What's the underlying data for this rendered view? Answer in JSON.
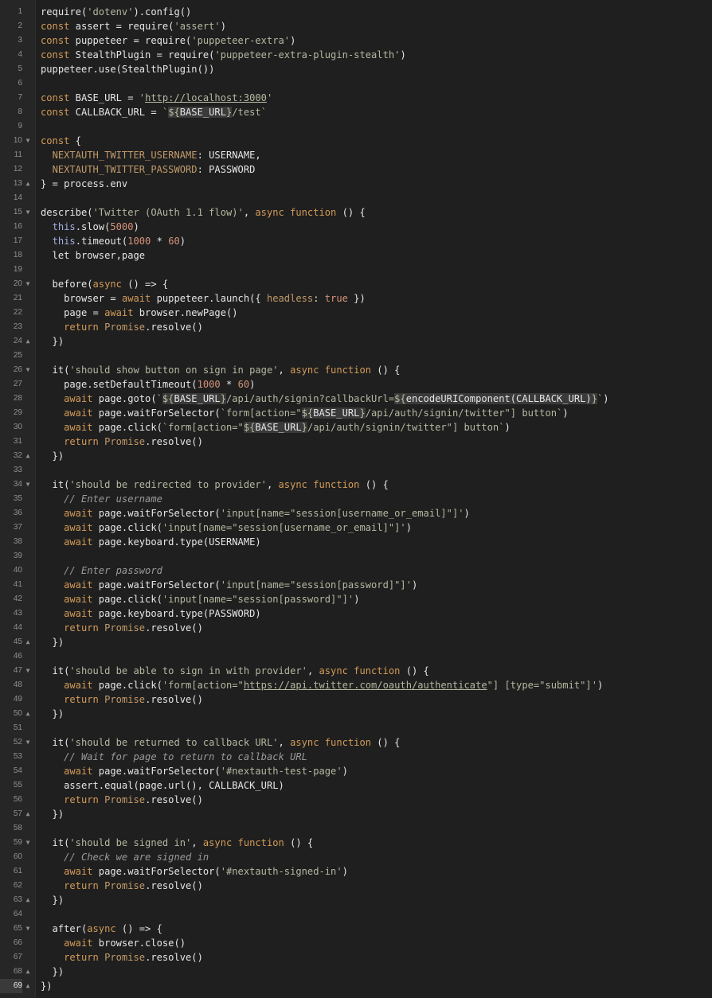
{
  "editor": {
    "current_line": 69,
    "lines": [
      {
        "n": 1,
        "segs": [
          [
            "p",
            "require("
          ],
          [
            "s",
            "'dotenv'"
          ],
          [
            "p",
            ").config()"
          ]
        ]
      },
      {
        "n": 2,
        "segs": [
          [
            "k",
            "const"
          ],
          [
            "p",
            " assert = require("
          ],
          [
            "s",
            "'assert'"
          ],
          [
            "p",
            ")"
          ]
        ]
      },
      {
        "n": 3,
        "segs": [
          [
            "k",
            "const"
          ],
          [
            "p",
            " puppeteer = require("
          ],
          [
            "s",
            "'puppeteer-extra'"
          ],
          [
            "p",
            ")"
          ]
        ]
      },
      {
        "n": 4,
        "segs": [
          [
            "k",
            "const"
          ],
          [
            "p",
            " StealthPlugin = require("
          ],
          [
            "s",
            "'puppeteer-extra-plugin-stealth'"
          ],
          [
            "p",
            ")"
          ]
        ]
      },
      {
        "n": 5,
        "segs": [
          [
            "p",
            "puppeteer.use(StealthPlugin())"
          ]
        ]
      },
      {
        "n": 6,
        "segs": []
      },
      {
        "n": 7,
        "segs": [
          [
            "k",
            "const"
          ],
          [
            "p",
            " BASE_URL = "
          ],
          [
            "s",
            "'"
          ],
          [
            "u",
            "http://localhost:3000"
          ],
          [
            "s",
            "'"
          ]
        ]
      },
      {
        "n": 8,
        "segs": [
          [
            "k",
            "const"
          ],
          [
            "p",
            " CALLBACK_URL = "
          ],
          [
            "s",
            "`"
          ],
          [
            "ip",
            "${BASE_URL}"
          ],
          [
            "s",
            "/test`"
          ]
        ]
      },
      {
        "n": 9,
        "segs": []
      },
      {
        "n": 10,
        "fold": "down",
        "segs": [
          [
            "k",
            "const"
          ],
          [
            "p",
            " {"
          ]
        ]
      },
      {
        "n": 11,
        "segs": [
          [
            "p",
            "  "
          ],
          [
            "cn",
            "NEXTAUTH_TWITTER_USERNAME"
          ],
          [
            "p",
            ": USERNAME,"
          ]
        ]
      },
      {
        "n": 12,
        "segs": [
          [
            "p",
            "  "
          ],
          [
            "cn",
            "NEXTAUTH_TWITTER_PASSWORD"
          ],
          [
            "p",
            ": PASSWORD"
          ]
        ]
      },
      {
        "n": 13,
        "fold": "up",
        "segs": [
          [
            "p",
            "} = process.env"
          ]
        ]
      },
      {
        "n": 14,
        "segs": []
      },
      {
        "n": 15,
        "fold": "down",
        "segs": [
          [
            "p",
            "describe("
          ],
          [
            "s",
            "'Twitter (OAuth 1.1 flow)'"
          ],
          [
            "p",
            ", "
          ],
          [
            "k",
            "async function"
          ],
          [
            "p",
            " () {"
          ]
        ]
      },
      {
        "n": 16,
        "segs": [
          [
            "p",
            "  "
          ],
          [
            "ti",
            "this"
          ],
          [
            "p",
            ".slow("
          ],
          [
            "n",
            "5000"
          ],
          [
            "p",
            ")"
          ]
        ]
      },
      {
        "n": 17,
        "segs": [
          [
            "p",
            "  "
          ],
          [
            "ti",
            "this"
          ],
          [
            "p",
            ".timeout("
          ],
          [
            "n",
            "1000"
          ],
          [
            "p",
            " * "
          ],
          [
            "n",
            "60"
          ],
          [
            "p",
            ")"
          ]
        ]
      },
      {
        "n": 18,
        "segs": [
          [
            "p",
            "  let browser,page"
          ]
        ]
      },
      {
        "n": 19,
        "segs": []
      },
      {
        "n": 20,
        "fold": "down",
        "segs": [
          [
            "p",
            "  before("
          ],
          [
            "k",
            "async"
          ],
          [
            "p",
            " () => {"
          ]
        ]
      },
      {
        "n": 21,
        "segs": [
          [
            "p",
            "    browser = "
          ],
          [
            "k",
            "await"
          ],
          [
            "p",
            " puppeteer.launch({ "
          ],
          [
            "cn",
            "headless"
          ],
          [
            "p",
            ": "
          ],
          [
            "b",
            "true"
          ],
          [
            "p",
            " })"
          ]
        ]
      },
      {
        "n": 22,
        "segs": [
          [
            "p",
            "    page = "
          ],
          [
            "k",
            "await"
          ],
          [
            "p",
            " browser.newPage()"
          ]
        ]
      },
      {
        "n": 23,
        "segs": [
          [
            "p",
            "    "
          ],
          [
            "k",
            "return"
          ],
          [
            "p",
            " "
          ],
          [
            "cn",
            "Promise"
          ],
          [
            "p",
            ".resolve()"
          ]
        ]
      },
      {
        "n": 24,
        "fold": "up",
        "segs": [
          [
            "p",
            "  })"
          ]
        ]
      },
      {
        "n": 25,
        "segs": []
      },
      {
        "n": 26,
        "fold": "down",
        "segs": [
          [
            "p",
            "  it("
          ],
          [
            "s",
            "'should show button on sign in page'"
          ],
          [
            "p",
            ", "
          ],
          [
            "k",
            "async function"
          ],
          [
            "p",
            " () {"
          ]
        ]
      },
      {
        "n": 27,
        "segs": [
          [
            "p",
            "    page.setDefaultTimeout("
          ],
          [
            "n",
            "1000"
          ],
          [
            "p",
            " * "
          ],
          [
            "n",
            "60"
          ],
          [
            "p",
            ")"
          ]
        ]
      },
      {
        "n": 28,
        "segs": [
          [
            "p",
            "    "
          ],
          [
            "k",
            "await"
          ],
          [
            "p",
            " page.goto("
          ],
          [
            "s",
            "`"
          ],
          [
            "ip",
            "${BASE_URL}"
          ],
          [
            "s",
            "/api/auth/signin?callbackUrl="
          ],
          [
            "ip",
            "${encodeURIComponent(CALLBACK_URL)}"
          ],
          [
            "s",
            "`"
          ],
          [
            "p",
            ")"
          ]
        ]
      },
      {
        "n": 29,
        "segs": [
          [
            "p",
            "    "
          ],
          [
            "k",
            "await"
          ],
          [
            "p",
            " page.waitForSelector("
          ],
          [
            "s",
            "`form[action=\""
          ],
          [
            "ip",
            "${BASE_URL}"
          ],
          [
            "s",
            "/api/auth/signin/twitter\"] button`"
          ],
          [
            "p",
            ")"
          ]
        ]
      },
      {
        "n": 30,
        "segs": [
          [
            "p",
            "    "
          ],
          [
            "k",
            "await"
          ],
          [
            "p",
            " page.click("
          ],
          [
            "s",
            "`form[action=\""
          ],
          [
            "ip",
            "${BASE_URL}"
          ],
          [
            "s",
            "/api/auth/signin/twitter\"] button`"
          ],
          [
            "p",
            ")"
          ]
        ]
      },
      {
        "n": 31,
        "segs": [
          [
            "p",
            "    "
          ],
          [
            "k",
            "return"
          ],
          [
            "p",
            " "
          ],
          [
            "cn",
            "Promise"
          ],
          [
            "p",
            ".resolve()"
          ]
        ]
      },
      {
        "n": 32,
        "fold": "up",
        "segs": [
          [
            "p",
            "  })"
          ]
        ]
      },
      {
        "n": 33,
        "segs": []
      },
      {
        "n": 34,
        "fold": "down",
        "segs": [
          [
            "p",
            "  it("
          ],
          [
            "s",
            "'should be redirected to provider'"
          ],
          [
            "p",
            ", "
          ],
          [
            "k",
            "async function"
          ],
          [
            "p",
            " () {"
          ]
        ]
      },
      {
        "n": 35,
        "segs": [
          [
            "p",
            "    "
          ],
          [
            "c",
            "// Enter username"
          ]
        ]
      },
      {
        "n": 36,
        "segs": [
          [
            "p",
            "    "
          ],
          [
            "k",
            "await"
          ],
          [
            "p",
            " page.waitForSelector("
          ],
          [
            "s",
            "'input[name=\"session[username_or_email]\"]'"
          ],
          [
            "p",
            ")"
          ]
        ]
      },
      {
        "n": 37,
        "segs": [
          [
            "p",
            "    "
          ],
          [
            "k",
            "await"
          ],
          [
            "p",
            " page.click("
          ],
          [
            "s",
            "'input[name=\"session[username_or_email]\"]'"
          ],
          [
            "p",
            ")"
          ]
        ]
      },
      {
        "n": 38,
        "segs": [
          [
            "p",
            "    "
          ],
          [
            "k",
            "await"
          ],
          [
            "p",
            " page.keyboard.type(USERNAME)"
          ]
        ]
      },
      {
        "n": 39,
        "segs": []
      },
      {
        "n": 40,
        "segs": [
          [
            "p",
            "    "
          ],
          [
            "c",
            "// Enter password"
          ]
        ]
      },
      {
        "n": 41,
        "segs": [
          [
            "p",
            "    "
          ],
          [
            "k",
            "await"
          ],
          [
            "p",
            " page.waitForSelector("
          ],
          [
            "s",
            "'input[name=\"session[password]\"]'"
          ],
          [
            "p",
            ")"
          ]
        ]
      },
      {
        "n": 42,
        "segs": [
          [
            "p",
            "    "
          ],
          [
            "k",
            "await"
          ],
          [
            "p",
            " page.click("
          ],
          [
            "s",
            "'input[name=\"session[password]\"]'"
          ],
          [
            "p",
            ")"
          ]
        ]
      },
      {
        "n": 43,
        "segs": [
          [
            "p",
            "    "
          ],
          [
            "k",
            "await"
          ],
          [
            "p",
            " page.keyboard.type(PASSWORD)"
          ]
        ]
      },
      {
        "n": 44,
        "segs": [
          [
            "p",
            "    "
          ],
          [
            "k",
            "return"
          ],
          [
            "p",
            " "
          ],
          [
            "cn",
            "Promise"
          ],
          [
            "p",
            ".resolve()"
          ]
        ]
      },
      {
        "n": 45,
        "fold": "up",
        "segs": [
          [
            "p",
            "  })"
          ]
        ]
      },
      {
        "n": 46,
        "segs": []
      },
      {
        "n": 47,
        "fold": "down",
        "segs": [
          [
            "p",
            "  it("
          ],
          [
            "s",
            "'should be able to sign in with provider'"
          ],
          [
            "p",
            ", "
          ],
          [
            "k",
            "async function"
          ],
          [
            "p",
            " () {"
          ]
        ]
      },
      {
        "n": 48,
        "segs": [
          [
            "p",
            "    "
          ],
          [
            "k",
            "await"
          ],
          [
            "p",
            " page.click("
          ],
          [
            "s",
            "'form[action=\""
          ],
          [
            "u",
            "https://api.twitter.com/oauth/authenticate"
          ],
          [
            "s",
            "\"] [type=\"submit\"]'"
          ],
          [
            "p",
            ")"
          ]
        ]
      },
      {
        "n": 49,
        "segs": [
          [
            "p",
            "    "
          ],
          [
            "k",
            "return"
          ],
          [
            "p",
            " "
          ],
          [
            "cn",
            "Promise"
          ],
          [
            "p",
            ".resolve()"
          ]
        ]
      },
      {
        "n": 50,
        "fold": "up",
        "segs": [
          [
            "p",
            "  })"
          ]
        ]
      },
      {
        "n": 51,
        "segs": []
      },
      {
        "n": 52,
        "fold": "down",
        "segs": [
          [
            "p",
            "  it("
          ],
          [
            "s",
            "'should be returned to callback URL'"
          ],
          [
            "p",
            ", "
          ],
          [
            "k",
            "async function"
          ],
          [
            "p",
            " () {"
          ]
        ]
      },
      {
        "n": 53,
        "segs": [
          [
            "p",
            "    "
          ],
          [
            "c",
            "// Wait for page to return to callback URL"
          ]
        ]
      },
      {
        "n": 54,
        "segs": [
          [
            "p",
            "    "
          ],
          [
            "k",
            "await"
          ],
          [
            "p",
            " page.waitForSelector("
          ],
          [
            "s",
            "'#nextauth-test-page'"
          ],
          [
            "p",
            ")"
          ]
        ]
      },
      {
        "n": 55,
        "segs": [
          [
            "p",
            "    assert.equal(page.url(), CALLBACK_URL)"
          ]
        ]
      },
      {
        "n": 56,
        "segs": [
          [
            "p",
            "    "
          ],
          [
            "k",
            "return"
          ],
          [
            "p",
            " "
          ],
          [
            "cn",
            "Promise"
          ],
          [
            "p",
            ".resolve()"
          ]
        ]
      },
      {
        "n": 57,
        "fold": "up",
        "segs": [
          [
            "p",
            "  })"
          ]
        ]
      },
      {
        "n": 58,
        "segs": []
      },
      {
        "n": 59,
        "fold": "down",
        "segs": [
          [
            "p",
            "  it("
          ],
          [
            "s",
            "'should be signed in'"
          ],
          [
            "p",
            ", "
          ],
          [
            "k",
            "async function"
          ],
          [
            "p",
            " () {"
          ]
        ]
      },
      {
        "n": 60,
        "segs": [
          [
            "p",
            "    "
          ],
          [
            "c",
            "// Check we are signed in"
          ]
        ]
      },
      {
        "n": 61,
        "segs": [
          [
            "p",
            "    "
          ],
          [
            "k",
            "await"
          ],
          [
            "p",
            " page.waitForSelector("
          ],
          [
            "s",
            "'#nextauth-signed-in'"
          ],
          [
            "p",
            ")"
          ]
        ]
      },
      {
        "n": 62,
        "segs": [
          [
            "p",
            "    "
          ],
          [
            "k",
            "return"
          ],
          [
            "p",
            " "
          ],
          [
            "cn",
            "Promise"
          ],
          [
            "p",
            ".resolve()"
          ]
        ]
      },
      {
        "n": 63,
        "fold": "up",
        "segs": [
          [
            "p",
            "  })"
          ]
        ]
      },
      {
        "n": 64,
        "segs": []
      },
      {
        "n": 65,
        "fold": "down",
        "segs": [
          [
            "p",
            "  after("
          ],
          [
            "k",
            "async"
          ],
          [
            "p",
            " () => {"
          ]
        ]
      },
      {
        "n": 66,
        "segs": [
          [
            "p",
            "    "
          ],
          [
            "k",
            "await"
          ],
          [
            "p",
            " browser.close()"
          ]
        ]
      },
      {
        "n": 67,
        "segs": [
          [
            "p",
            "    "
          ],
          [
            "k",
            "return"
          ],
          [
            "p",
            " "
          ],
          [
            "cn",
            "Promise"
          ],
          [
            "p",
            ".resolve()"
          ]
        ]
      },
      {
        "n": 68,
        "fold": "up",
        "segs": [
          [
            "p",
            "  })"
          ]
        ]
      },
      {
        "n": 69,
        "fold": "up",
        "segs": [
          [
            "p",
            "})"
          ]
        ]
      }
    ]
  }
}
